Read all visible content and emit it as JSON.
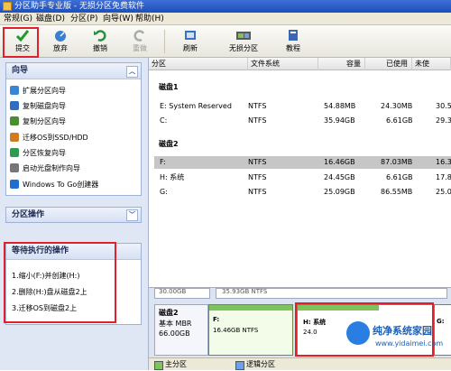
{
  "window": {
    "title": "分区助手专业版 - 无损分区免费软件"
  },
  "menu": [
    "常规(G)",
    "磁盘(D)",
    "分区(P)",
    "向导(W)",
    "帮助(H)"
  ],
  "toolbar": {
    "commit": "提交",
    "discard": "放弃",
    "undo": "撤销",
    "redo": "重做",
    "refresh": "刷新",
    "lossless": "无损分区",
    "tutorial": "教程"
  },
  "wizard": {
    "title": "向导",
    "items": [
      "扩展分区向导",
      "复制磁盘向导",
      "复制分区向导",
      "迁移OS到SSD/HDD",
      "分区恢复向导",
      "启动光盘制作向导",
      "Windows To Go创建器"
    ]
  },
  "partition_ops": {
    "title": "分区操作"
  },
  "pending": {
    "title": "等待执行的操作",
    "items": [
      "1.缩小(F:)并创建(H:)",
      "2.删除(H:)盘从磁盘2上",
      "3.迁移OS到磁盘2上"
    ]
  },
  "columns": [
    "分区",
    "文件系统",
    "容量",
    "已使用",
    "未使"
  ],
  "disk1": {
    "label": "磁盘1",
    "rows": [
      {
        "name": "E: System Reserved",
        "fs": "NTFS",
        "cap": "54.88MB",
        "used": "24.30MB",
        "free": "30.5"
      },
      {
        "name": "C:",
        "fs": "NTFS",
        "cap": "35.94GB",
        "used": "6.61GB",
        "free": "29.3"
      }
    ]
  },
  "disk2": {
    "label": "磁盘2",
    "rows": [
      {
        "name": "F:",
        "fs": "NTFS",
        "cap": "16.46GB",
        "used": "87.03MB",
        "free": "16.3"
      },
      {
        "name": "H: 系统",
        "fs": "NTFS",
        "cap": "24.45GB",
        "used": "6.61GB",
        "free": "17.8"
      },
      {
        "name": "G:",
        "fs": "NTFS",
        "cap": "25.09GB",
        "used": "86.55MB",
        "free": "25.0"
      }
    ]
  },
  "map": {
    "prev_size": "30.00GB",
    "prev_detail": "35.93GB NTFS",
    "disk_name": "磁盘2",
    "disk_type": "基本 MBR",
    "disk_size": "66.00GB",
    "part_f_name": "F:",
    "part_f_detail": "16.46GB NTFS",
    "part_h_name": "H: 系统",
    "part_h_detail": "24.0",
    "part_g_name": "G:"
  },
  "legend": {
    "primary": "主分区",
    "logical": "逻辑分区"
  },
  "watermark": {
    "line1": "纯净系统家园",
    "line2": "www.yidaimei.com"
  },
  "colors": {
    "accent_red": "#e0202a",
    "primary_green": "#7ec45d"
  }
}
